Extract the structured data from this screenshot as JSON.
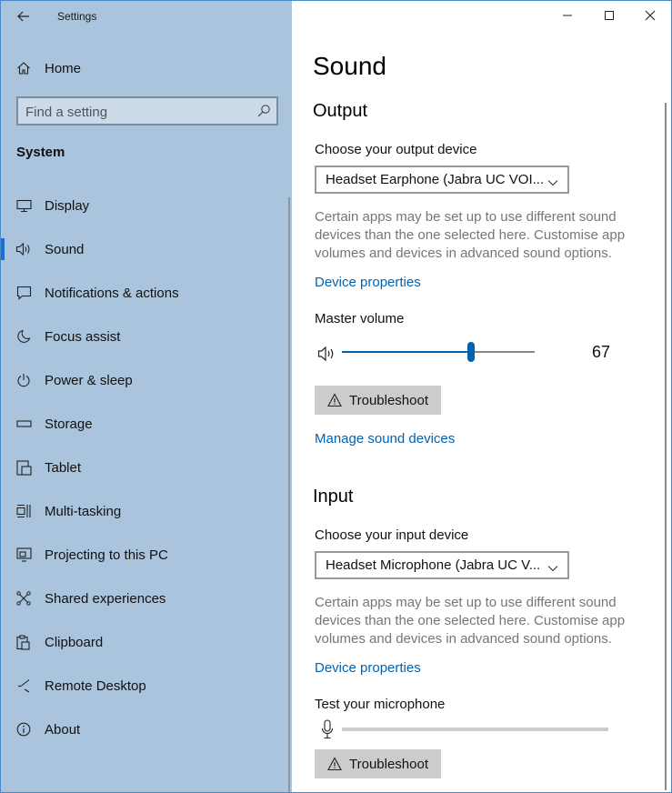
{
  "window": {
    "title": "Settings",
    "controls": {
      "minimize": "minimize-icon",
      "maximize": "maximize-icon",
      "close": "close-icon"
    }
  },
  "sidebar": {
    "home_label": "Home",
    "search_placeholder": "Find a setting",
    "section_title": "System",
    "items": [
      {
        "label": "Display",
        "icon": "monitor-icon"
      },
      {
        "label": "Sound",
        "icon": "speaker-icon",
        "selected": true
      },
      {
        "label": "Notifications & actions",
        "icon": "notification-icon"
      },
      {
        "label": "Focus assist",
        "icon": "moon-icon"
      },
      {
        "label": "Power & sleep",
        "icon": "power-icon"
      },
      {
        "label": "Storage",
        "icon": "storage-icon"
      },
      {
        "label": "Tablet",
        "icon": "tablet-icon"
      },
      {
        "label": "Multi-tasking",
        "icon": "multitasking-icon"
      },
      {
        "label": "Projecting to this PC",
        "icon": "projecting-icon"
      },
      {
        "label": "Shared experiences",
        "icon": "shared-icon"
      },
      {
        "label": "Clipboard",
        "icon": "clipboard-icon"
      },
      {
        "label": "Remote Desktop",
        "icon": "remote-desktop-icon"
      },
      {
        "label": "About",
        "icon": "info-icon"
      }
    ]
  },
  "main": {
    "page_title": "Sound",
    "output": {
      "heading": "Output",
      "choose_label": "Choose your output device",
      "device_value": "Headset Earphone (Jabra UC VOI...",
      "description": "Certain apps may be set up to use different sound devices than the one selected here. Customise app volumes and devices in advanced sound options.",
      "device_properties_link": "Device properties",
      "master_volume_label": "Master volume",
      "volume_value": "67",
      "volume_level": 0.67,
      "troubleshoot_label": "Troubleshoot",
      "manage_link": "Manage sound devices"
    },
    "input": {
      "heading": "Input",
      "choose_label": "Choose your input device",
      "device_value": "Headset Microphone (Jabra UC V...",
      "description": "Certain apps may be set up to use different sound devices than the one selected here. Customise app volumes and devices in advanced sound options.",
      "device_properties_link": "Device properties",
      "test_mic_label": "Test your microphone",
      "mic_level": 0,
      "troubleshoot_label": "Troubleshoot"
    }
  },
  "colors": {
    "sidebar_bg": "#a9c4dc",
    "accent": "#0063b1",
    "selection_bar": "#1a6fd1"
  }
}
